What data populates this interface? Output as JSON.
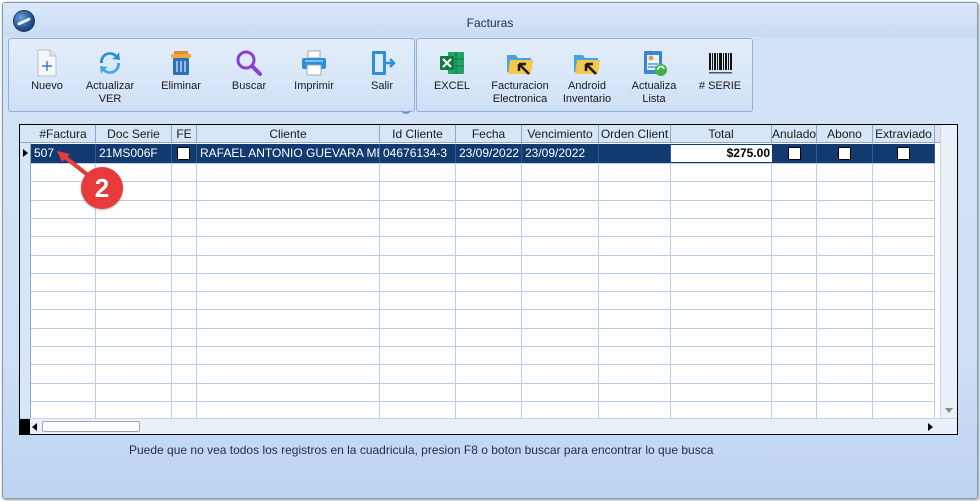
{
  "window": {
    "title": "Facturas"
  },
  "toolbar_main": [
    {
      "label": "Nuevo",
      "icon": "new-document-icon"
    },
    {
      "label": "Actualizar\nVER",
      "icon": "refresh-icon"
    },
    {
      "label": "Eliminar",
      "icon": "trash-icon"
    },
    {
      "label": "Buscar",
      "icon": "search-icon"
    },
    {
      "label": "Imprimir",
      "icon": "printer-icon"
    },
    {
      "label": "Salir",
      "icon": "exit-icon"
    }
  ],
  "toolbar_extra": [
    {
      "label": "EXCEL",
      "icon": "excel-icon"
    },
    {
      "label": "Facturacion\nElectronica",
      "icon": "folder-arrow-icon"
    },
    {
      "label": "Android\nInventario",
      "icon": "folder-arrow-icon"
    },
    {
      "label": "Actualiza\nLista",
      "icon": "list-refresh-icon"
    },
    {
      "label": "# SERIE",
      "icon": "barcode-icon"
    }
  ],
  "grid": {
    "columns": [
      "#Factura",
      "Doc Serie",
      "FE",
      "Cliente",
      "Id Cliente",
      "Fecha",
      "Vencimiento",
      "Orden Client",
      "Total",
      "Anulado",
      "Abono",
      "Extraviado"
    ],
    "rows": [
      {
        "factura": "507",
        "doc_serie": "21MS006F",
        "fe": false,
        "cliente": "RAFAEL ANTONIO GUEVARA ME",
        "id_cliente": "04676134-3",
        "fecha": "23/09/2022",
        "vencimiento": "23/09/2022",
        "orden_cliente": "",
        "total": "$275.00",
        "anulado": false,
        "abono": false,
        "extraviado": false
      }
    ]
  },
  "callout": {
    "number": "2",
    "color": "#e83a3a"
  },
  "hint": "Puede que no vea todos los registros en la cuadricula, presion F8 o boton buscar para encontrar lo que busca",
  "colors": {
    "selected_row": "#123a6e",
    "header": "#d7e6f7",
    "toolbar_border": "#8fb0d8"
  }
}
